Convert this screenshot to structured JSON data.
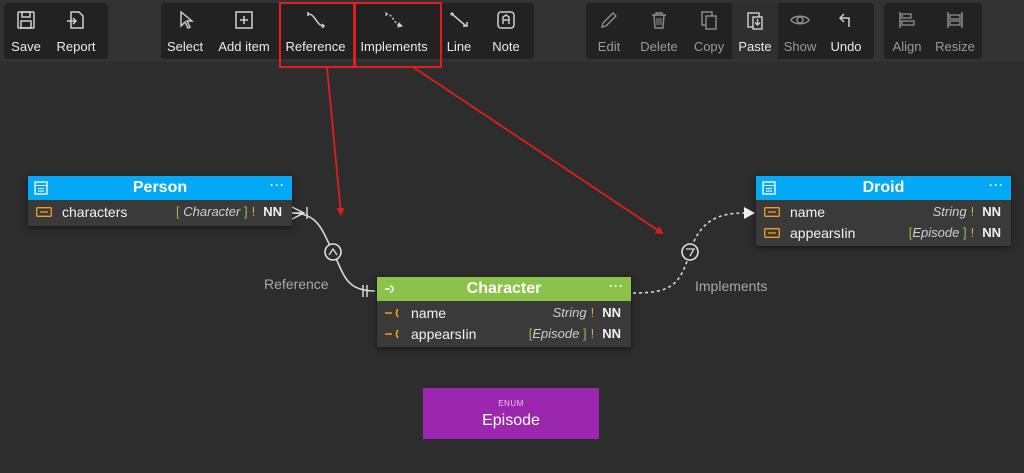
{
  "toolbar": {
    "save": "Save",
    "report": "Report",
    "select": "Select",
    "add_item": "Add item",
    "reference": "Reference",
    "implements": "Implements",
    "line": "Line",
    "note": "Note",
    "edit": "Edit",
    "delete": "Delete",
    "copy": "Copy",
    "paste": "Paste",
    "show": "Show",
    "undo": "Undo",
    "align": "Align",
    "resize": "Resize"
  },
  "tables": {
    "person": {
      "title": "Person",
      "color": "#03a9f4",
      "more": "···",
      "rows": [
        {
          "name": "characters",
          "type": "Character",
          "bang": "!",
          "nn": "NN"
        }
      ]
    },
    "droid": {
      "title": "Droid",
      "color": "#03a9f4",
      "more": "···",
      "rows": [
        {
          "name": "name",
          "type": "String",
          "bang": "!",
          "nn": "NN"
        },
        {
          "name": "appearsIin",
          "type": "Episode",
          "bang": "!",
          "nn": "NN"
        }
      ]
    },
    "character": {
      "title": "Character",
      "color": "#8bc34a",
      "more": "···",
      "rows": [
        {
          "name": "name",
          "type": "String",
          "bang": "!",
          "nn": "NN"
        },
        {
          "name": "appearsIin",
          "type": "Episode",
          "bang": "!",
          "nn": "NN"
        }
      ]
    }
  },
  "enum": {
    "tag": "ENUM",
    "name": "Episode",
    "color": "#9b27af"
  },
  "connections": {
    "reference_label": "Reference",
    "implements_label": "Implements"
  },
  "annotation_color": "#e01e1e",
  "icons": [
    "save-icon",
    "report-icon",
    "select-icon",
    "add-item-icon",
    "reference-icon",
    "implements-icon",
    "line-icon",
    "note-icon",
    "edit-icon",
    "delete-icon",
    "copy-icon",
    "paste-icon",
    "show-icon",
    "undo-icon",
    "align-icon",
    "resize-icon"
  ]
}
